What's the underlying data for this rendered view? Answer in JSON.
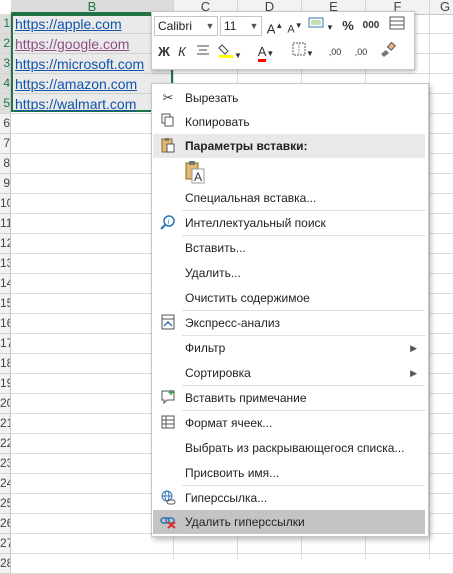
{
  "columns": [
    "B",
    "C",
    "D",
    "E",
    "F",
    "G"
  ],
  "rows": [
    "1",
    "2",
    "3",
    "4",
    "5",
    "6",
    "7",
    "8",
    "9",
    "10",
    "11",
    "12",
    "13",
    "14",
    "15",
    "16",
    "17",
    "18",
    "19",
    "20",
    "21",
    "22",
    "23",
    "24",
    "25",
    "26",
    "27",
    "28"
  ],
  "cells": [
    "https://apple.com",
    "https://google.com",
    "https://microsoft.com",
    "https://amazon.com",
    "https://walmart.com"
  ],
  "toolbar": {
    "font_name": "Calibri",
    "font_size": "11",
    "grow_font": "A",
    "shrink_font": "A",
    "percent": "%",
    "thousands": "000",
    "bold": "Ж",
    "italic": "К",
    "font_color_letter": "A",
    "inc_decimal": ",00",
    "dec_decimal": ",00"
  },
  "menu": {
    "cut": "Вырезать",
    "copy": "Копировать",
    "paste_options": "Параметры вставки:",
    "paste_special": "Специальная вставка...",
    "smart_lookup": "Интеллектуальный поиск",
    "insert": "Вставить...",
    "delete": "Удалить...",
    "clear_contents": "Очистить содержимое",
    "quick_analysis": "Экспресс-анализ",
    "filter": "Фильтр",
    "sort": "Сортировка",
    "insert_comment": "Вставить примечание",
    "format_cells": "Формат ячеек...",
    "pick_from_list": "Выбрать из раскрывающегося списка...",
    "define_name": "Присвоить имя...",
    "hyperlink": "Гиперссылка...",
    "remove_hyperlinks": "Удалить гиперссылки"
  },
  "colors": {
    "accent": "#217346",
    "link": "#1155aa",
    "visited_link": "#8e4f86",
    "highlight_yellow": "#ffff00",
    "font_red": "#ff0000"
  }
}
